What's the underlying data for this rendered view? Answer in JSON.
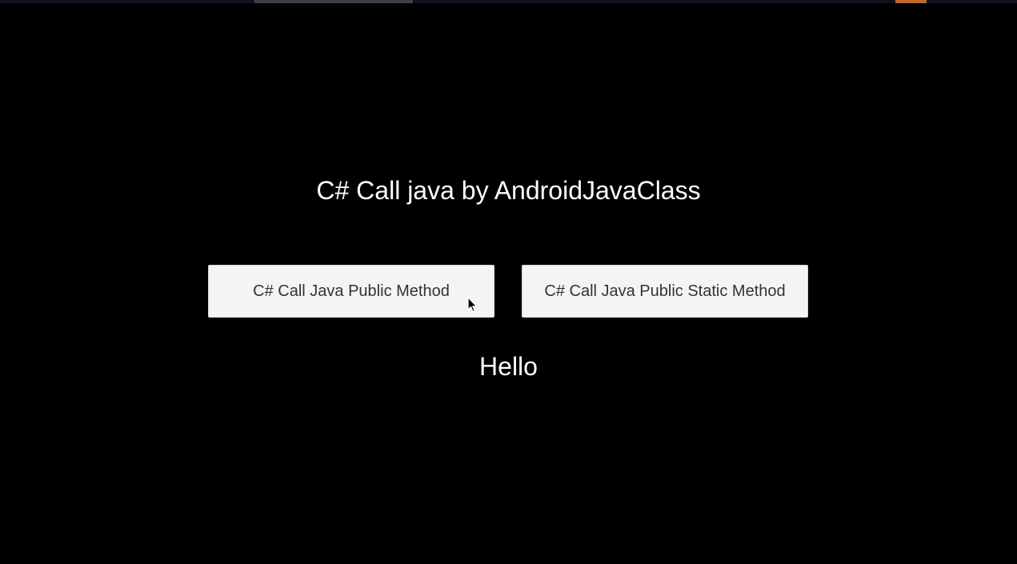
{
  "app": {
    "title": "C# Call java by AndroidJavaClass",
    "buttons": {
      "public_method_label": "C# Call Java Public Method",
      "public_static_method_label": "C# Call Java Public Static Method"
    },
    "output_text": "Hello"
  },
  "colors": {
    "background": "#000000",
    "text": "#ffffff",
    "button_background": "#f4f4f4",
    "button_text": "#333333",
    "accent": "#d0621f"
  },
  "icons": {
    "cursor": "mouse-pointer-icon"
  }
}
